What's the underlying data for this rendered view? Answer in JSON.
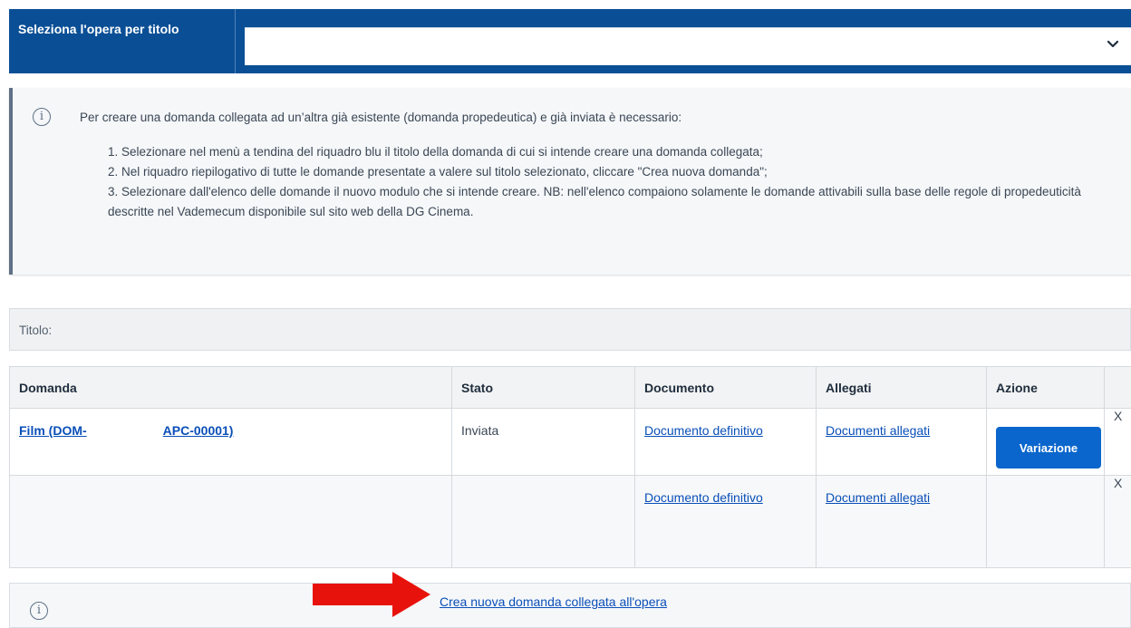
{
  "selector": {
    "label": "Seleziona l'opera per titolo",
    "value": ""
  },
  "info": {
    "intro": "Per creare una domanda collegata ad un’altra già esistente (domanda propedeutica) e già inviata è necessario:",
    "steps": [
      "1. Selezionare nel menù a tendina del riquadro blu il titolo della domanda di cui si intende creare una domanda collegata;",
      "2. Nel riquadro riepilogativo di tutte le domande presentate a valere sul titolo selezionato, cliccare \"Crea nuova domanda\";",
      "3. Selezionare dall'elenco delle domande il nuovo modulo che si intende creare. NB: nell'elenco compaiono solamente le domande attivabili sulla base delle regole di propedeuticità descritte nel Vademecum disponibile sul sito web della DG Cinema."
    ]
  },
  "title_bar": {
    "label": "Titolo:"
  },
  "table": {
    "headers": [
      "Domanda",
      "Stato",
      "Documento",
      "Allegati",
      "Azione"
    ],
    "rows": [
      {
        "domanda_part1": "Film (DOM-",
        "domanda_part2": "APC-00001)",
        "stato": "Inviata",
        "documento": "Documento definitivo",
        "allegati": "Documenti allegati",
        "azione": "Variazione",
        "extra": "X"
      },
      {
        "domanda_part1": "",
        "domanda_part2": "",
        "stato": "",
        "documento": "Documento definitivo",
        "allegati": "Documenti allegati",
        "azione": "",
        "extra": "X"
      }
    ]
  },
  "bottom": {
    "create_link": "Crea nuova domanda collegata all'opera"
  },
  "colors": {
    "primary_blue": "#0a4f96",
    "button_blue": "#0a66cc",
    "arrow_red": "#e8120c"
  },
  "icons": [
    "chevron-down-icon",
    "info-icon",
    "red-arrow"
  ]
}
